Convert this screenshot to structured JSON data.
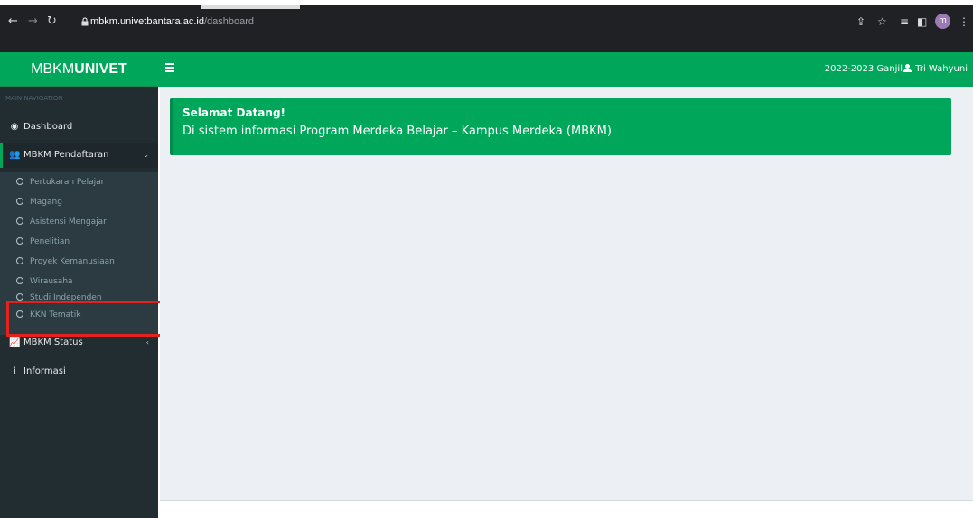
{
  "browser": {
    "url_host": "mbkm.univetbantara.ac.id",
    "url_path": "/dashboard",
    "profile_initial": "m",
    "icons": [
      "back-icon",
      "forward-icon",
      "reload-icon",
      "lock-icon",
      "share-icon",
      "star-icon",
      "reading-list-icon",
      "side-panel-icon",
      "profile-icon",
      "menu-icon"
    ]
  },
  "brand": {
    "bold": "MBKM",
    "rest": "UNIVET"
  },
  "navbar": {
    "year": "2022-2023 Ganjil",
    "user": "Tri Wahyuni"
  },
  "sidebar": {
    "header": "MAIN NAVIGATION",
    "dashboard": "Dashboard",
    "pendaftaran": "MBKM Pendaftaran",
    "sub_items": [
      "Pertukaran Pelajar",
      "Magang",
      "Asistensi Mengajar",
      "Penelitian",
      "Proyek Kemanusiaan",
      "Wirausaha",
      "Studi Independen",
      "KKN Tematik"
    ],
    "status": "MBKM Status",
    "informasi": "Informasi"
  },
  "alert": {
    "title": "Selamat Datang!",
    "body": "Di sistem informasi Program Merdeka Belajar – Kampus Merdeka (MBKM)"
  },
  "colors": {
    "brand_green": "#00a65a",
    "sidebar_dark": "#222d32",
    "highlight_red": "#e3221d"
  }
}
